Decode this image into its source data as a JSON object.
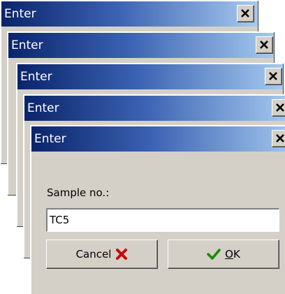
{
  "dialogs": [
    {
      "title": "Enter"
    },
    {
      "title": "Enter"
    },
    {
      "title": "Enter"
    },
    {
      "title": "Enter"
    },
    {
      "title": "Enter"
    }
  ],
  "front_dialog": {
    "field_label": "Sample no.:",
    "field_value": "TC5",
    "cancel_label": "Cancel",
    "ok_label_accel": "O",
    "ok_label_rest": "K"
  },
  "icons": {
    "close": "close-icon",
    "cancel": "red-x-icon",
    "ok": "green-check-icon"
  },
  "colors": {
    "title_gradient_start": "#0a246a",
    "title_gradient_end": "#a6caf0",
    "dialog_bg": "#d4d0c8",
    "cancel_icon": "#cc0000",
    "ok_icon": "#1a8a00"
  }
}
